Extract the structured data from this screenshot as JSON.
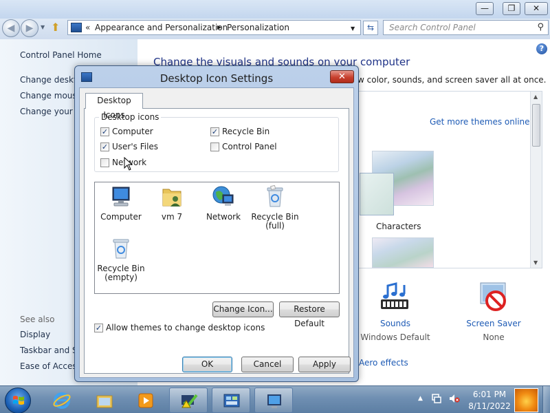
{
  "explorer": {
    "controls": {
      "minimize": "—",
      "maximize": "❐",
      "close": "✕"
    },
    "address": {
      "crumbs": [
        "Appearance and Personalization",
        "Personalization"
      ],
      "chevron": "«",
      "separator": "▶"
    },
    "search": {
      "placeholder": "Search Control Panel"
    },
    "left_pane": {
      "home": "Control Panel Home",
      "links": [
        "Change deskto",
        "Change mouse",
        "Change your ic"
      ],
      "see_also_heading": "See also",
      "see_also": [
        "Display",
        "Taskbar and Sta",
        "Ease of Access"
      ]
    },
    "content": {
      "title": "Change the visuals and sounds on your computer",
      "subtitle": "w color, sounds, and screen saver all at once.",
      "get_more_themes": "Get more themes online",
      "theme_name": "Characters",
      "sounds": {
        "label": "Sounds",
        "value": "Windows Default"
      },
      "screen_saver": {
        "label": "Screen Saver",
        "value": "None"
      },
      "aero_link": "Aero effects"
    }
  },
  "dialog": {
    "title": "Desktop Icon Settings",
    "tab": "Desktop Icons",
    "group_label": "Desktop icons",
    "checkboxes": {
      "computer": {
        "label": "Computer",
        "checked": true
      },
      "user_files": {
        "label": "User's Files",
        "checked": true
      },
      "network": {
        "label": "Network",
        "checked": false
      },
      "recycle_bin": {
        "label": "Recycle Bin",
        "checked": true
      },
      "control_panel": {
        "label": "Control Panel",
        "checked": false
      }
    },
    "icons": {
      "computer": {
        "label": "Computer",
        "icon": "computer-monitor"
      },
      "vm7": {
        "label": "vm 7",
        "icon": "user-folder"
      },
      "network": {
        "label": "Network",
        "icon": "network-globe"
      },
      "recycle_full": {
        "label": "Recycle Bin\n(full)",
        "icon": "recycle-bin-full"
      },
      "recycle_empty": {
        "label": "Recycle Bin\n(empty)",
        "icon": "recycle-bin-empty"
      }
    },
    "change_icon": "Change Icon...",
    "restore_default": "Restore Default",
    "allow_themes": {
      "label": "Allow themes to change desktop icons",
      "checked": true
    },
    "ok": "OK",
    "cancel": "Cancel",
    "apply": "Apply"
  },
  "taskbar": {
    "time": "6:01 PM",
    "date": "8/11/2022"
  },
  "colors": {
    "link": "#1e5bb5",
    "title_blue": "#1e3287",
    "close_red": "#c8402e"
  }
}
